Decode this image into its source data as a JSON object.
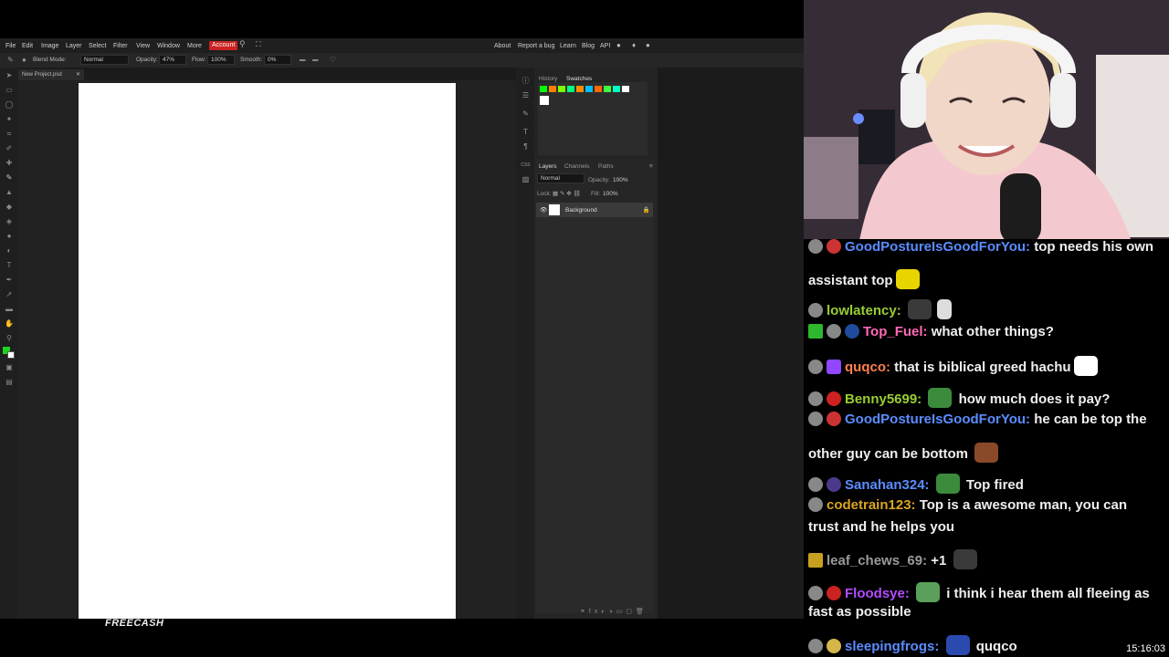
{
  "editor": {
    "menu": [
      "File",
      "Edit",
      "Image",
      "Layer",
      "Select",
      "Filter",
      "View",
      "Window",
      "More",
      "Account"
    ],
    "links": [
      "About",
      "Report a bug",
      "Learn",
      "Blog",
      "API"
    ],
    "options": {
      "blend_mode_label": "Blend Mode:",
      "blend_mode_value": "Normal",
      "opacity_label": "Opacity:",
      "opacity_value": "47%",
      "flow_label": "Flow:",
      "flow_value": "100%",
      "smooth_label": "Smooth:",
      "smooth_value": "0%"
    },
    "doc_tab": "New Project.psd",
    "panel_tabs": {
      "history": "History",
      "swatches": "Swatches"
    },
    "swatch_colors": [
      "#00ff00",
      "#ff8000",
      "#80ff00",
      "#00ff80",
      "#ff8c00",
      "#00c0ff",
      "#ff6600",
      "#40ff40",
      "#00ffc0",
      "#ffffff"
    ],
    "layers": {
      "tabs": [
        "Layers",
        "Channels",
        "Paths"
      ],
      "blend": "Normal",
      "opacity_label": "Opacity:",
      "opacity_value": "100%",
      "lock_label": "Lock:",
      "fill_label": "Fill:",
      "fill_value": "100%",
      "layer_name": "Background"
    }
  },
  "brand": "FREECASH",
  "chat": [
    {
      "user": "GoodPostureIsGoodForYou:",
      "user_color": "#5b8cff",
      "text": "top needs his own"
    },
    {
      "user": "",
      "user_color": "#ffffff",
      "text": "assistant top"
    },
    {
      "user": "lowlatency:",
      "user_color": "#9acd32",
      "text": ""
    },
    {
      "user": "Top_Fuel:",
      "user_color": "#ff69b4",
      "text": "what other things?"
    },
    {
      "user": "quqco:",
      "user_color": "#ff7f50",
      "text": "that is biblical greed hachu"
    },
    {
      "user": "Benny5699:",
      "user_color": "#9acd32",
      "text": "how much does it pay?"
    },
    {
      "user": "GoodPostureIsGoodForYou:",
      "user_color": "#5b8cff",
      "text": "he can be top the"
    },
    {
      "user": "",
      "user_color": "#ffffff",
      "text": "other guy can be bottom"
    },
    {
      "user": "Sanahan324:",
      "user_color": "#5b8cff",
      "text": "Top fired"
    },
    {
      "user": "codetrain123:",
      "user_color": "#daa520",
      "text": "Top is a awesome man, you can"
    },
    {
      "user": "",
      "user_color": "#ffffff",
      "text": "trust and he helps you"
    },
    {
      "user": "leaf_chews_69:",
      "user_color": "#9a9a9a",
      "text": "+1"
    },
    {
      "user": "Floodsye:",
      "user_color": "#b44cff",
      "text": "i think i hear them all fleeing as"
    },
    {
      "user": "",
      "user_color": "#ffffff",
      "text": "fast as possible"
    },
    {
      "user": "sleepingfrogs:",
      "user_color": "#5b8cff",
      "text": "quqco"
    }
  ],
  "clock": "15:16:03"
}
